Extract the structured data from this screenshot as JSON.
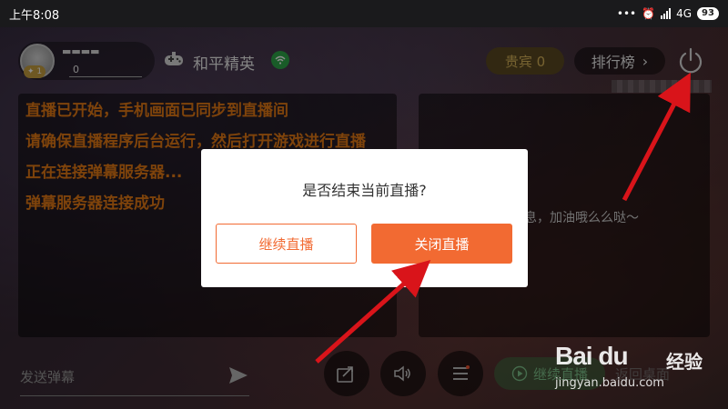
{
  "status_bar": {
    "time": "上午8:08",
    "network": "4G",
    "battery": "93"
  },
  "header": {
    "user_count": "0",
    "user_level": "1",
    "game_name": "和平精英",
    "vip_label": "贵宾 0",
    "rank_label": "排行榜"
  },
  "log": {
    "lines": [
      "直播已开始，手机画面已同步到直播间",
      "请确保直播程序后台运行，然后打开游戏进行直播",
      "正在连接弹幕服务器...",
      "弹幕服务器连接成功"
    ]
  },
  "chat": {
    "welcome_fragment": "息，加油哦么么哒～"
  },
  "bottom": {
    "danmaku_placeholder": "发送弹幕",
    "continue_label": "继续直播",
    "return_label": "返回桌面"
  },
  "dialog": {
    "title": "是否结束当前直播?",
    "continue_button": "继续直播",
    "close_button": "关闭直播",
    "accent_color": "#f26a32"
  },
  "watermark": {
    "logo": "Bai du",
    "jingyan": "经验",
    "url": "jingyan.baidu.com"
  },
  "icons": {
    "power": "power-icon",
    "send": "send-icon",
    "share": "share-icon",
    "volume": "volume-icon",
    "menu": "menu-icon",
    "play": "play-icon",
    "gamepad": "gamepad-icon"
  }
}
